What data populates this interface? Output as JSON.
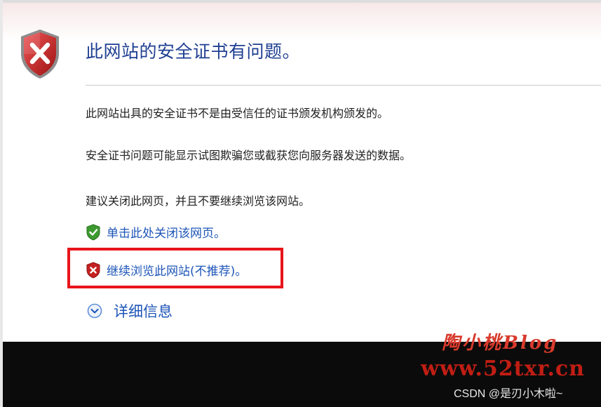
{
  "title": "此网站的安全证书有问题。",
  "paragraphs": [
    "此网站出具的安全证书不是由受信任的证书颁发机构颁发的。",
    "安全证书问题可能显示试图欺骗您或截获您向服务器发送的数据。",
    "建议关闭此网页，并且不要继续浏览该网站。"
  ],
  "links": {
    "close": "单击此处关闭该网页。",
    "continue": "继续浏览此网站(不推荐)。"
  },
  "details": "详细信息",
  "watermark": {
    "logo": "陶小桃Blog",
    "url": "www.52txr.cn",
    "credit": "CSDN @是刃小木啦~"
  },
  "colors": {
    "title": "#1f3f92",
    "link": "#1d55b8",
    "highlight": "#e8141b",
    "shield_red": "#c42121",
    "shield_green": "#3c9a2e"
  }
}
